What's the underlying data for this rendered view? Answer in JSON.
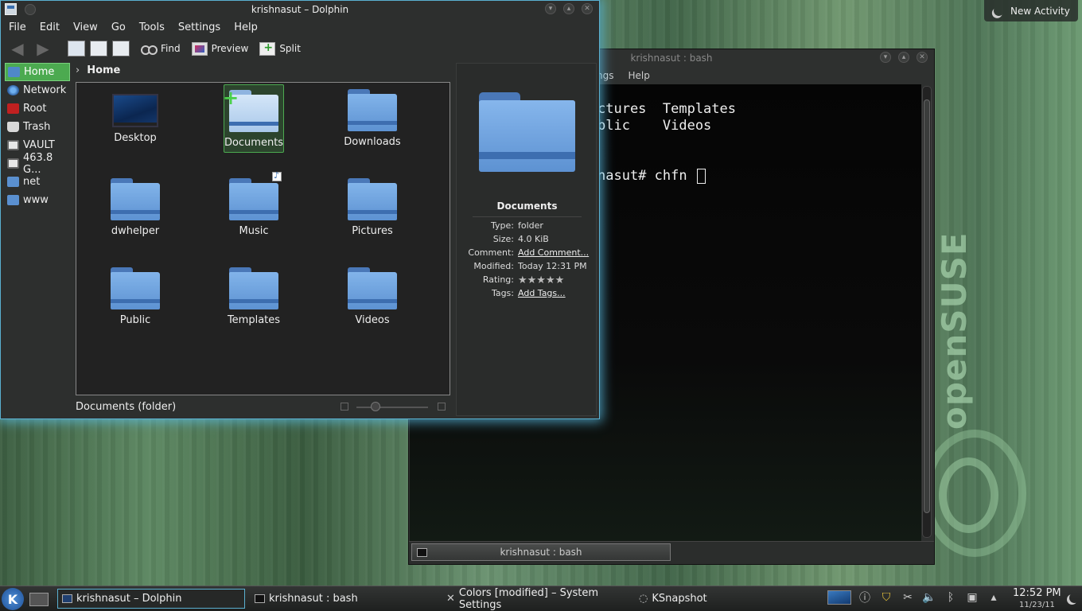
{
  "desktop": {
    "new_activity": "New Activity",
    "brand": "openSUSE"
  },
  "konsole": {
    "title": "krishnasut : bash",
    "menu": [
      "ngs",
      "Help"
    ],
    "lines": [
      "ctures  Templates",
      "blic    Videos",
      "",
      "nasut# chfn "
    ],
    "tab_label": "krishnasut : bash"
  },
  "dolphin": {
    "title": "krishnasut – Dolphin",
    "menu": [
      "File",
      "Edit",
      "View",
      "Go",
      "Tools",
      "Settings",
      "Help"
    ],
    "toolbar": {
      "find": "Find",
      "preview": "Preview",
      "split": "Split"
    },
    "places": [
      {
        "label": "Home",
        "icon": "home-icon"
      },
      {
        "label": "Network",
        "icon": "network-icon"
      },
      {
        "label": "Root",
        "icon": "root-icon"
      },
      {
        "label": "Trash",
        "icon": "trash-icon"
      },
      {
        "label": "VAULT",
        "icon": "drive-icon"
      },
      {
        "label": "463.8 G...",
        "icon": "drive-icon"
      },
      {
        "label": "net",
        "icon": "folder-icon"
      },
      {
        "label": "www",
        "icon": "folder-icon"
      }
    ],
    "breadcrumb": "Home",
    "items": [
      "Desktop",
      "Documents",
      "Downloads",
      "dwhelper",
      "Music",
      "Pictures",
      "Public",
      "Templates",
      "Videos"
    ],
    "status": "Documents (folder)",
    "info": {
      "name": "Documents",
      "rows": [
        {
          "key": "Type:",
          "value": "folder"
        },
        {
          "key": "Size:",
          "value": "4.0 KiB"
        },
        {
          "key": "Comment:",
          "value": "Add Comment..."
        },
        {
          "key": "Modified:",
          "value": "Today 12:31 PM"
        },
        {
          "key": "Rating:",
          "value": "★★★★★"
        },
        {
          "key": "Tags:",
          "value": "Add Tags..."
        }
      ]
    }
  },
  "taskbar": {
    "tasks": [
      "krishnasut – Dolphin",
      "krishnasut : bash",
      "Colors [modified] – System Settings",
      "KSnapshot"
    ],
    "time": "12:52 PM",
    "date": "11/23/11"
  }
}
